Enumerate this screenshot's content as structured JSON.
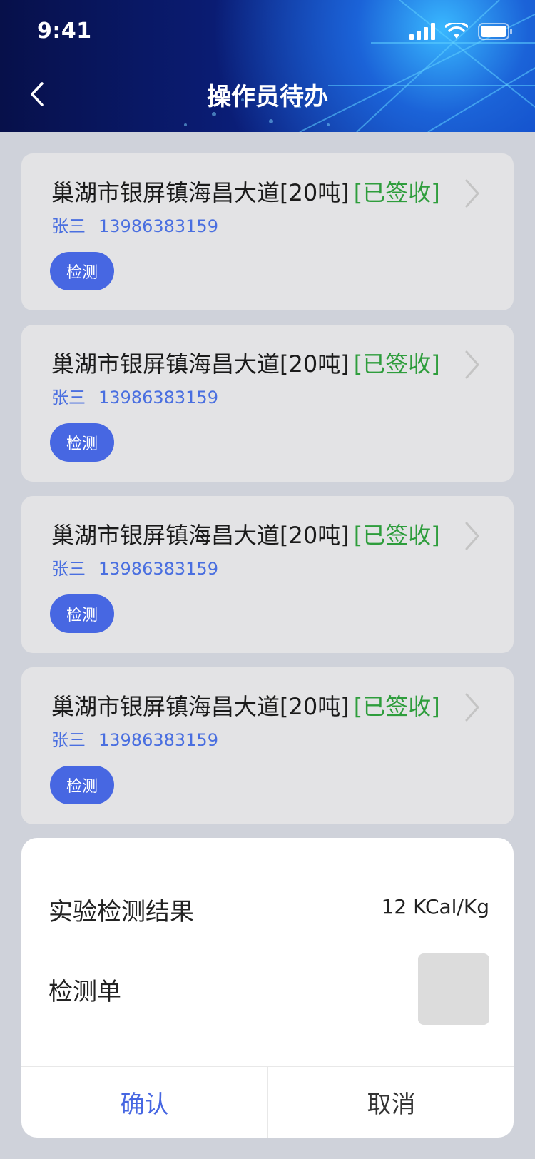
{
  "status_bar": {
    "time": "9:41"
  },
  "nav": {
    "title": "操作员待办",
    "back_icon": "chevron-left-icon"
  },
  "cards": [
    {
      "title": "巢湖市银屏镇海昌大道[20吨]",
      "status": "[已签收]",
      "name": "张三",
      "phone": "13986383159",
      "tag": "检测"
    },
    {
      "title": "巢湖市银屏镇海昌大道[20吨]",
      "status": "[已签收]",
      "name": "张三",
      "phone": "13986383159",
      "tag": "检测"
    },
    {
      "title": "巢湖市银屏镇海昌大道[20吨]",
      "status": "[已签收]",
      "name": "张三",
      "phone": "13986383159",
      "tag": "检测"
    },
    {
      "title": "巢湖市银屏镇海昌大道[20吨]",
      "status": "[已签收]",
      "name": "张三",
      "phone": "13986383159",
      "tag": "检测"
    }
  ],
  "dialog": {
    "result_label": "实验检测结果",
    "result_value": "12 KCal/Kg",
    "form_label": "检测单",
    "confirm_label": "确认",
    "cancel_label": "取消"
  },
  "colors": {
    "accent": "#4767e2",
    "status_green": "#2e9d3c",
    "card_bg": "#e3e3e5",
    "page_bg": "#cfd2da"
  }
}
